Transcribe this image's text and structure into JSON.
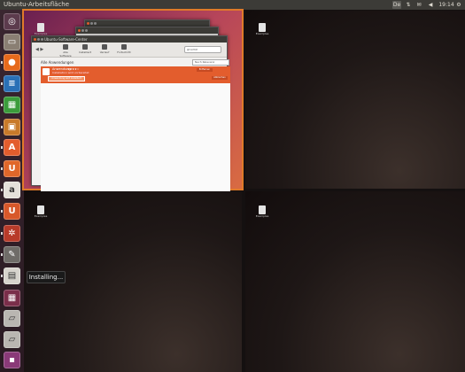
{
  "topbar": {
    "title": "Ubuntu-Arbeitsfläche",
    "keyboard": "De",
    "clock": "19:14",
    "network_icon": "network-icon",
    "mail_icon": "mail-icon",
    "volume_icon": "volume-icon",
    "session_icon": "gear-icon"
  },
  "launcher": {
    "items": [
      {
        "name": "dash-home",
        "icon": "ubuntu-logo-icon",
        "glyph": "◎",
        "color": "#5c3b4d"
      },
      {
        "name": "files",
        "icon": "folder-icon",
        "glyph": "▭",
        "color": "#8a7f73"
      },
      {
        "name": "firefox",
        "icon": "firefox-icon",
        "glyph": "●",
        "color": "#e66a1c"
      },
      {
        "name": "libreoffice-writer",
        "icon": "writer-icon",
        "glyph": "≡",
        "color": "#2a70b6"
      },
      {
        "name": "libreoffice-calc",
        "icon": "calc-icon",
        "glyph": "▦",
        "color": "#3b9c3b"
      },
      {
        "name": "libreoffice-impress",
        "icon": "impress-icon",
        "glyph": "▣",
        "color": "#c87a2a"
      },
      {
        "name": "software-center",
        "icon": "software-center-icon",
        "glyph": "A",
        "color": "#e35d2d"
      },
      {
        "name": "ubuntu-one",
        "icon": "ubuntu-one-icon",
        "glyph": "U",
        "color": "#e0672a"
      },
      {
        "name": "amazon",
        "icon": "amazon-icon",
        "glyph": "a",
        "color": "#e4e0da"
      },
      {
        "name": "ubuntu-one-music",
        "icon": "ubuntu-one-music-icon",
        "glyph": "U",
        "color": "#d8582a"
      },
      {
        "name": "system-settings",
        "icon": "settings-icon",
        "glyph": "✲",
        "color": "#b83b2a"
      },
      {
        "name": "installing-app",
        "icon": "install-icon",
        "glyph": "✎",
        "color": "#6f6c68"
      },
      {
        "name": "text-editor",
        "icon": "text-editor-icon",
        "glyph": "▤",
        "color": "#d7d4cd"
      },
      {
        "name": "workspace-switcher",
        "icon": "workspace-switcher-icon",
        "glyph": "▦",
        "color": "#7a2e4a"
      },
      {
        "name": "drive-1",
        "icon": "drive-icon",
        "glyph": "▱",
        "color": "#b9b6b1"
      },
      {
        "name": "drive-2",
        "icon": "drive-icon",
        "glyph": "▱",
        "color": "#b9b6b1"
      },
      {
        "name": "trash",
        "icon": "trash-icon",
        "glyph": "▪",
        "color": "#8a3a78"
      }
    ]
  },
  "tooltip": "Installing...",
  "desktop_icon_label": "Examples",
  "software_center": {
    "window_title": "Ubuntu-Software-Center",
    "back_title": "Examples",
    "toolbar": [
      "Alle Software",
      "Installiert",
      "Verlauf",
      "Fortschritt"
    ],
    "search_placeholder": "gnome",
    "heading": "Alle Anwendungen",
    "filter_label": "Nach Relevanz",
    "app_name": "Anwendung",
    "app_desc": "Installation wird vorbereitet",
    "stars": "★★★★☆",
    "status_button": "Anwendung wird installiert",
    "install_button": "Abbrechen",
    "remove_button": "Entfernen"
  },
  "colors": {
    "accent": "#e35d2d",
    "workspace_highlight": "#e07a2a"
  }
}
